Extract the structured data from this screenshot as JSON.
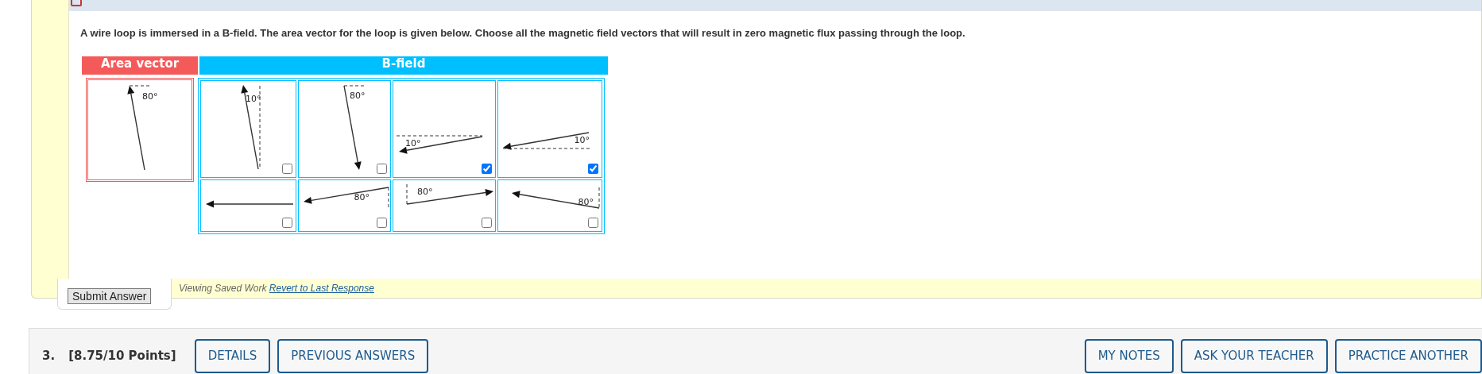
{
  "question": {
    "prompt": "A wire loop is immersed in a B-field. The area vector for the loop is given below. Choose all the magnetic field vectors that will result in zero magnetic flux passing through the loop.",
    "area_header": "Area vector",
    "bfield_header": "B-field",
    "area_vector": {
      "angle_label": "80°"
    },
    "options": [
      {
        "angle_label": "10°",
        "checked": false
      },
      {
        "angle_label": "80°",
        "checked": false
      },
      {
        "angle_label": "10°",
        "checked": true
      },
      {
        "angle_label": "10°",
        "checked": true
      },
      {
        "checked": false
      },
      {
        "angle_label": "80°",
        "checked": false
      },
      {
        "angle_label": "80°",
        "checked": false
      },
      {
        "angle_label": "80°",
        "checked": false
      }
    ],
    "submit_button": "Submit Answer",
    "status": "Viewing Saved Work",
    "revert_link": "Revert to Last Response"
  },
  "question_bar": {
    "number": "3.",
    "points": "[8.75/10 Points]",
    "left_buttons": [
      "DETAILS",
      "PREVIOUS ANSWERS"
    ],
    "right_buttons": [
      "MY NOTES",
      "ASK YOUR TEACHER",
      "PRACTICE ANOTHER"
    ]
  }
}
